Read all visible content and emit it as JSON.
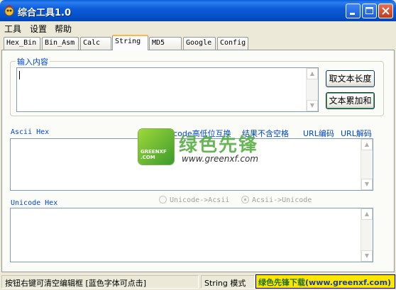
{
  "window": {
    "title": "综合工具1.0",
    "icon": "app-icon"
  },
  "menu": [
    "工具",
    "设置",
    "帮助"
  ],
  "tabs": [
    {
      "label": "Hex_Bin"
    },
    {
      "label": "Bin_Asm"
    },
    {
      "label": "Calc"
    },
    {
      "label": "String",
      "active": true
    },
    {
      "label": "MD5"
    },
    {
      "label": "Google"
    },
    {
      "label": "Config"
    }
  ],
  "input_group": {
    "label": "输入内容",
    "value": ""
  },
  "buttons": {
    "text_length": "取文本长度",
    "text_accumulate": "文本累加和"
  },
  "ascii_section": {
    "label": "Ascii Hex",
    "value": ""
  },
  "links": {
    "unicode_swap": "Unicode高低位互换",
    "no_spaces": "结果不含空格",
    "url_encode": "URL编码",
    "url_decode": "URL解码"
  },
  "unicode_section": {
    "label": "Unicode Hex",
    "value": ""
  },
  "radios": [
    {
      "label": "Unicode->Acsii",
      "checked": false
    },
    {
      "label": "Acsii->Unicode",
      "checked": true
    }
  ],
  "status": {
    "hint": "按钮右键可清空编辑框 [蓝色字体可点击]",
    "mode": "String 模式",
    "brand_name": "绿色先锋下载",
    "brand_url": "(www.greenxf.com)"
  },
  "watermark": {
    "logo_text_1": "GREENXF",
    "logo_text_2": ".COM",
    "title": "绿色先锋",
    "url": "www.greenxf.com"
  },
  "colors": {
    "titlebar": "#0550c8",
    "link": "#0046d5",
    "brand_bg": "#ffe600",
    "watermark_green": "#4faa3a"
  }
}
